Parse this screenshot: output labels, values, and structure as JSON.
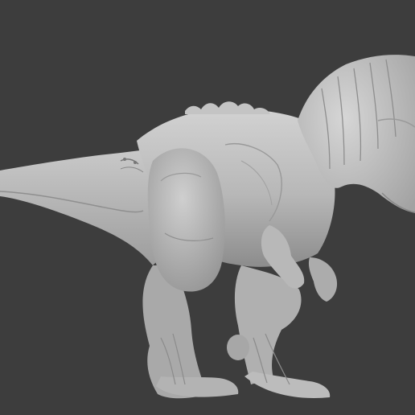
{
  "viewport": {
    "background_color": "#3d3d3d",
    "model_color": "#b9b9b9",
    "shadow_color": "#8a8a8a",
    "highlight_color": "#dcdcdc"
  },
  "model": {
    "subject": "dinosaur-sculpt",
    "material": "matcap-clay-grey"
  }
}
